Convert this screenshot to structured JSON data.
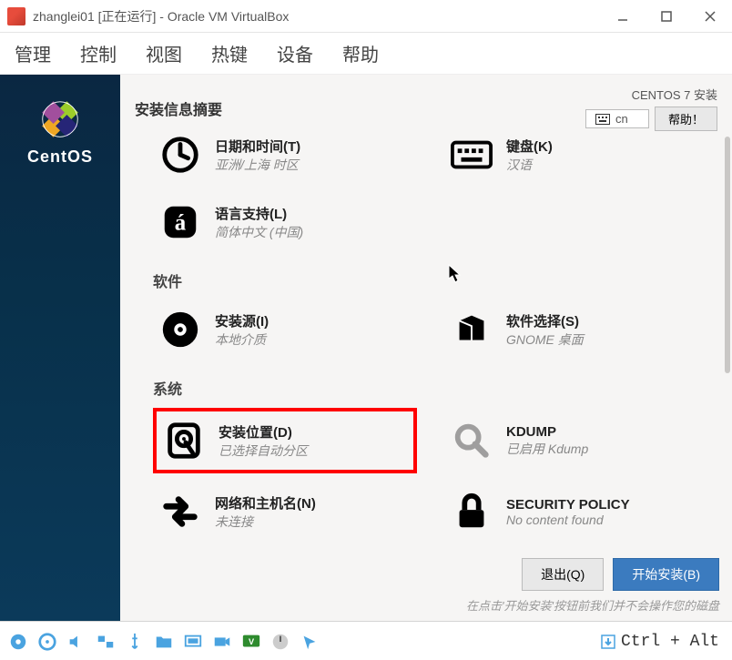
{
  "window": {
    "title": "zhanglei01 [正在运行] - Oracle VM VirtualBox",
    "menu": [
      "管理",
      "控制",
      "视图",
      "热键",
      "设备",
      "帮助"
    ]
  },
  "installer": {
    "brand": "CentOS",
    "header_title": "安装信息摘要",
    "distro": "CENTOS 7 安装",
    "keyboard": "cn",
    "help_label": "帮助！",
    "sections": {
      "local_top": [
        {
          "title": "日期和时间(T)",
          "sub": "亚洲/上海 时区",
          "icon": "clock"
        },
        {
          "title": "键盘(K)",
          "sub": "汉语",
          "icon": "keyboard"
        }
      ],
      "local_bottom": [
        {
          "title": "语言支持(L)",
          "sub": "简体中文 (中国)",
          "icon": "lang"
        }
      ],
      "software_label": "软件",
      "software": [
        {
          "title": "安装源(I)",
          "sub": "本地介质",
          "icon": "disc"
        },
        {
          "title": "软件选择(S)",
          "sub": "GNOME 桌面",
          "icon": "package"
        }
      ],
      "system_label": "系统",
      "system": [
        {
          "title": "安装位置(D)",
          "sub": "已选择自动分区",
          "icon": "hdd",
          "highlight": true
        },
        {
          "title": "KDUMP",
          "sub": "已启用 Kdump",
          "icon": "search",
          "dimmed": true
        },
        {
          "title": "网络和主机名(N)",
          "sub": "未连接",
          "icon": "network"
        },
        {
          "title": "SECURITY POLICY",
          "sub": "No content found",
          "icon": "lock"
        }
      ]
    },
    "footer": {
      "quit": "退出(Q)",
      "begin": "开始安装(B)",
      "note": "在点击'开始安装'按钮前我们并不会操作您的磁盘"
    }
  },
  "statusbar": {
    "hostkey": "Ctrl + Alt"
  }
}
